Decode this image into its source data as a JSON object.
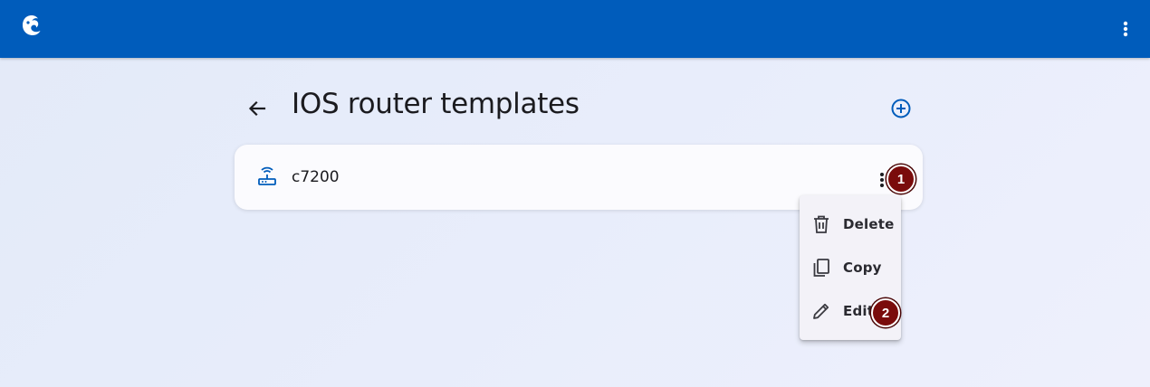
{
  "header": {
    "logo_icon": "chameleon-logo-icon",
    "menu_icon": "more-vert-icon",
    "bar_color": "#005cbb"
  },
  "page": {
    "title": "IOS router templates",
    "back_icon": "arrow-back-icon",
    "add_icon": "add-circle-icon"
  },
  "templates": [
    {
      "name": "c7200",
      "icon": "router-icon",
      "menu_icon": "more-vert-icon"
    }
  ],
  "context_menu": {
    "items": [
      {
        "label": "Delete",
        "icon": "delete-icon"
      },
      {
        "label": "Copy",
        "icon": "copy-icon"
      },
      {
        "label": "Edit",
        "icon": "edit-icon"
      }
    ]
  },
  "annotations": [
    {
      "label": "1",
      "color": "#7a0c0c"
    },
    {
      "label": "2",
      "color": "#7a0c0c"
    }
  ]
}
